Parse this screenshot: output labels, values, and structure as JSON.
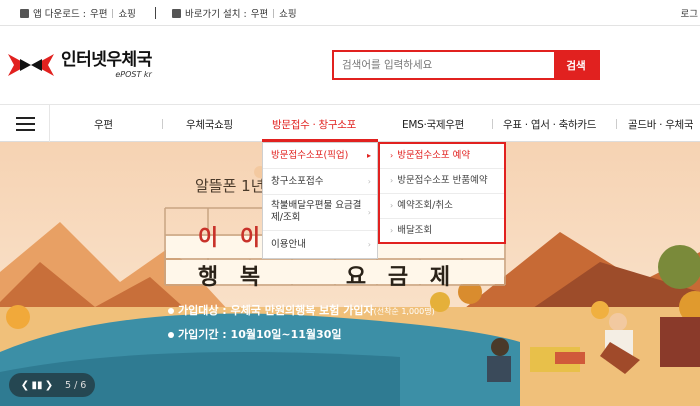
{
  "topbar": {
    "app_download_label": "앱 다운로드 :",
    "app_links": [
      "우편",
      "쇼핑"
    ],
    "shortcut_label": "바로가기 설치 :",
    "shortcut_links": [
      "우편",
      "쇼핑"
    ],
    "login_label": "로그"
  },
  "header": {
    "logo_main": "인터넷우체국",
    "logo_sub": "ePOST kr",
    "search_placeholder": "검색어를 입력하세요",
    "search_button": "검색"
  },
  "nav": {
    "items": [
      "우편",
      "우체국쇼핑",
      "방문접수 · 창구소포",
      "EMS·국제우편",
      "우표 · 엽서 · 축하카드",
      "골드바 · 우체국"
    ]
  },
  "dropdown": {
    "main_items": [
      {
        "label": "방문접수소포(픽업)",
        "active": true
      },
      {
        "label": "창구소포접수",
        "active": false
      },
      {
        "label": "착불배달우편물 요금결제/조회",
        "active": false
      },
      {
        "label": "이용안내",
        "active": false
      }
    ],
    "sub_items": [
      {
        "label": "방문접수소포 예약",
        "active": true
      },
      {
        "label": "방문접수소포 반품예약",
        "active": false
      },
      {
        "label": "예약조회/취소",
        "active": false
      },
      {
        "label": "배달조회",
        "active": false
      }
    ]
  },
  "banner": {
    "subtitle": "알뜰폰 1년",
    "row1": [
      "이",
      "이",
      "",
      "",
      "",
      "",
      "",
      ""
    ],
    "row2": [
      "행",
      "복",
      "",
      "요",
      "금",
      "제"
    ],
    "info_line1": "가입대상 : 우체국 만원의행복 보험 가입자",
    "info_line1_small": "(선착순 1,000명)",
    "info_line2": "가입기간 : 10월10일~11월30일",
    "page_indicator": "5 / 6"
  },
  "colors": {
    "accent": "#e1211f",
    "banner_bg": "#f8dfc4",
    "lake": "#3c8fa6"
  }
}
